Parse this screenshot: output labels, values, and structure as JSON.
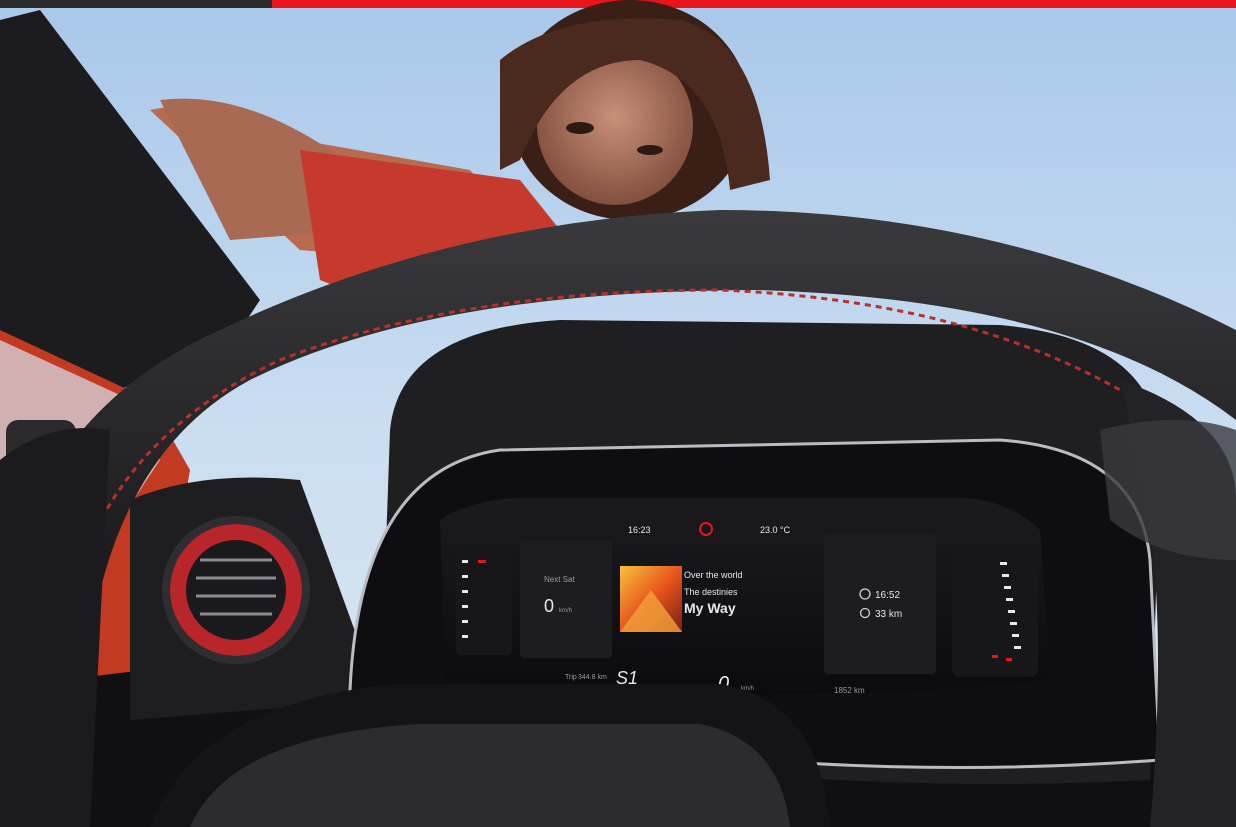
{
  "progress": {
    "fraction": 0.22,
    "accent": "#e8141c",
    "track": "#2a2a2c"
  },
  "cluster": {
    "time": "16:23",
    "temperature": "23.0 °C",
    "next_label": "Next Sat",
    "speed_left": "0",
    "speed_unit_small": "km/h",
    "media": {
      "line1": "Over the world",
      "line2": "The destinies",
      "title": "My Way"
    },
    "eta_time": "16:52",
    "distance": "33 km",
    "trip_label": "Trip",
    "trip_value": "344.8 km",
    "gear": "S1",
    "speed": "0",
    "speed_unit": "km/h",
    "odometer": "1852 km"
  },
  "colors": {
    "stitching": "#b7302a",
    "body_paint": "#c23a22",
    "vent_ring": "#b8252a"
  }
}
